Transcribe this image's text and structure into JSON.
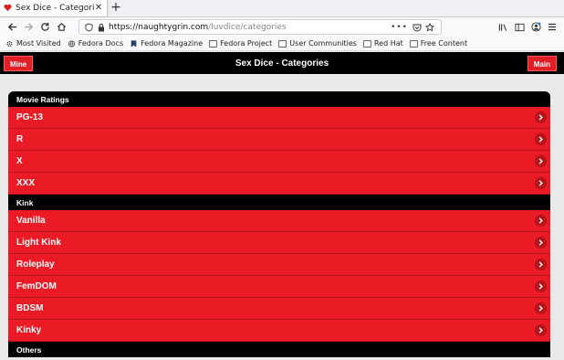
{
  "browser": {
    "tab_title": "Sex Dice - Categories",
    "url_domain": "https://naughtygrin.com",
    "url_path": "/luvdice/categories",
    "more_label": "•••",
    "bookmarks": [
      "Most Visited",
      "Fedora Docs",
      "Fedora Magazine",
      "Fedora Project",
      "User Communities",
      "Red Hat",
      "Free Content"
    ]
  },
  "app": {
    "title": "Sex Dice - Categories",
    "left_button": "Mine",
    "right_button": "Main"
  },
  "sections": [
    {
      "heading": "Movie Ratings",
      "items": [
        "PG-13",
        "R",
        "X",
        "XXX"
      ]
    },
    {
      "heading": "Kink",
      "items": [
        "Vanilla",
        "Light Kink",
        "Roleplay",
        "FemDOM",
        "BDSM",
        "Kinky"
      ]
    },
    {
      "heading": "Others",
      "items": []
    }
  ],
  "colors": {
    "accent": "#ea1b24",
    "header_bg": "#000000"
  }
}
